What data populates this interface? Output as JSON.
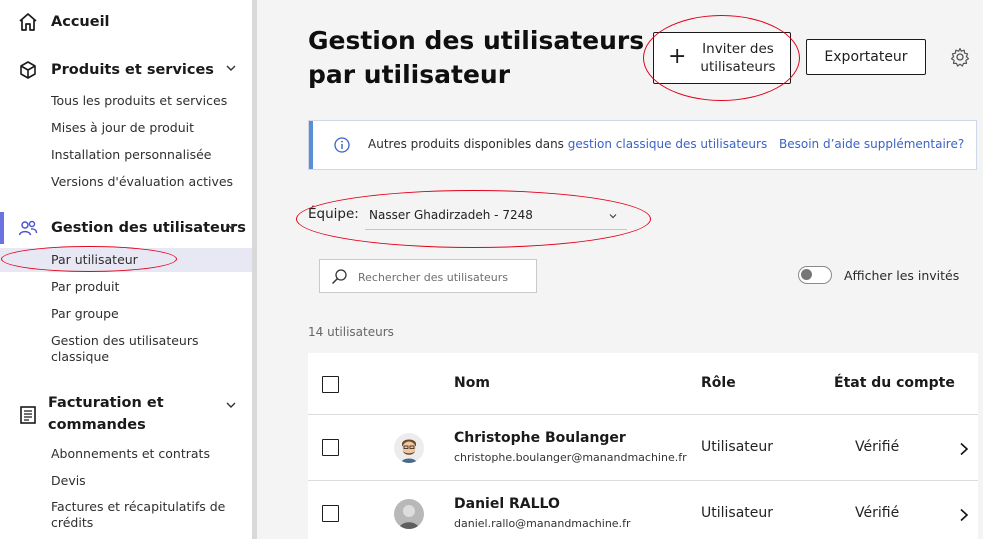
{
  "sidebar": {
    "home": {
      "label": "Accueil",
      "icon": "home-icon"
    },
    "products": {
      "label": "Produits et services",
      "icon": "cube-icon",
      "items": [
        "Tous les produits et services",
        "Mises à jour de produit",
        "Installation personnalisée",
        "Versions d'évaluation actives"
      ]
    },
    "users": {
      "label": "Gestion des utilisateurs",
      "icon": "users-icon",
      "items": [
        "Par utilisateur",
        "Par produit",
        "Par groupe",
        "Gestion des utilisateurs",
        "classique"
      ],
      "active_item": "Par utilisateur"
    },
    "billing": {
      "label_line1": "Facturation et",
      "label_line2": "commandes",
      "icon": "billing-icon",
      "items": [
        "Abonnements et contrats",
        "Devis",
        "Factures et récapitulatifs de",
        "crédits"
      ]
    }
  },
  "header": {
    "title_line1": "Gestion des utilisateurs",
    "title_line2": "par utilisateur",
    "invite_label_line1": "Inviter des",
    "invite_label_line2": "utilisateurs",
    "export_label": "Exportateur"
  },
  "banner": {
    "text": "Autres produits disponibles dans ",
    "link": "gestion classique des utilisateurs",
    "help": "Besoin d’aide supplémentaire?"
  },
  "team": {
    "label": "Équipe:",
    "value": "Nasser Ghadirzadeh - 7248"
  },
  "search": {
    "placeholder": "Rechercher des utilisateurs"
  },
  "toggle": {
    "label": "Afficher les invités",
    "on": false
  },
  "user_count": "14 utilisateurs",
  "table": {
    "columns": [
      "Nom",
      "Rôle",
      "État du compte"
    ],
    "rows": [
      {
        "name": "Christophe Boulanger",
        "email": "christophe.boulanger@manandmachine.fr",
        "role": "Utilisateur",
        "state": "Vérifié"
      },
      {
        "name": "Daniel RALLO",
        "email": "daniel.rallo@manandmachine.fr",
        "role": "Utilisateur",
        "state": "Vérifié"
      }
    ]
  },
  "colors": {
    "accent": "#6a73e0",
    "link": "#3b62c5",
    "annotation": "#e2001a"
  }
}
